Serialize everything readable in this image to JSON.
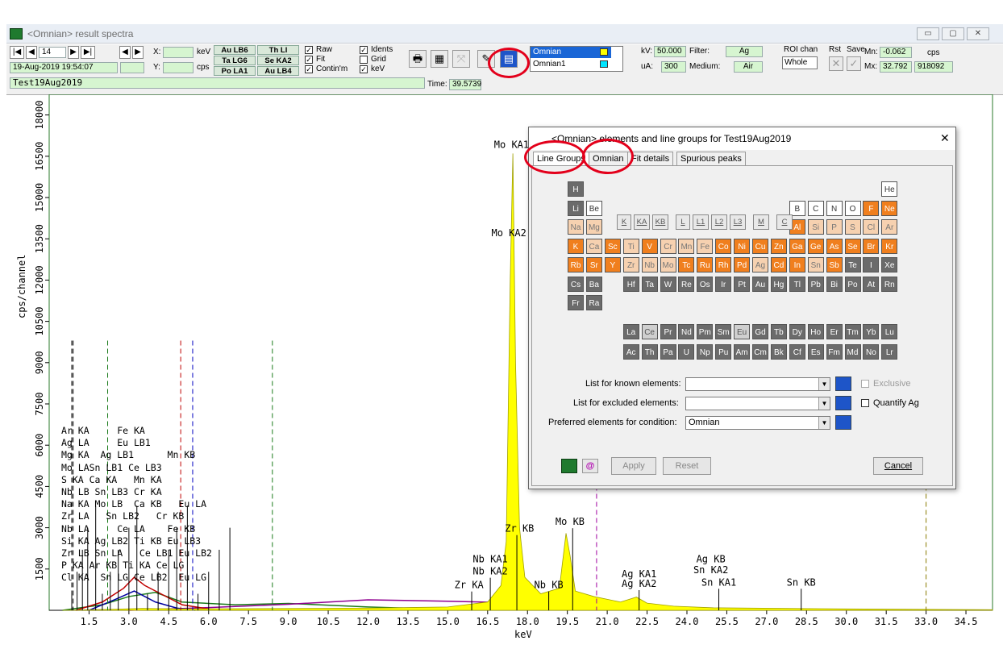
{
  "window": {
    "title": "<Omnian> result spectra",
    "controls": [
      "▭",
      "▢",
      "✕"
    ]
  },
  "toolbar": {
    "spectrum_index": "14",
    "nav": [
      "|◀",
      "◀",
      "▶",
      "▶|"
    ],
    "nav2": [
      "◀",
      "▶"
    ],
    "datetime": "19-Aug-2019 19:54:07",
    "sample_name": "Test19Aug2019",
    "x_label": "X:",
    "x_unit": "keV",
    "y_label": "Y:",
    "y_unit": "cps",
    "line_buttons": [
      "Au LB6",
      "Th Ll",
      "Ta LG6",
      "Se KA2",
      "Po LA1",
      "Au LB4"
    ],
    "checks": {
      "raw": "Raw",
      "fit": "Fit",
      "contin": "Contin'm",
      "idents": "Idents",
      "grid": "Grid",
      "kev": "keV"
    },
    "time_label": "Time:",
    "time_value": "39.5739",
    "spectra_list": [
      "Omnian",
      "Omnian1"
    ],
    "kv_label": "kV:",
    "kv_value": "50.000",
    "ua_label": "uA:",
    "ua_value": "300",
    "filter_label": "Filter:",
    "filter_value": "Ag",
    "medium_label": "Medium:",
    "medium_value": "Air",
    "roi_label": "ROI chan",
    "roi_value": "Whole",
    "rst_label": "Rst",
    "save_label": "Save",
    "mn_label": "Mn:",
    "mn_value": "-0.062",
    "mx_label": "Mx:",
    "mx_value": "32.792",
    "cps_label": "cps",
    "cps_value": "918092",
    "colors": {
      "omnian": "#ffff00",
      "omnian1": "#00e5ff"
    }
  },
  "chart_data": {
    "type": "line",
    "xlabel": "keV",
    "ylabel": "cps/channel",
    "xticks": [
      "1.5",
      "3.0",
      "4.5",
      "6.0",
      "7.5",
      "9.0",
      "10.5",
      "12.0",
      "13.5",
      "15.0",
      "16.5",
      "18.0",
      "19.5",
      "21.0",
      "22.5",
      "24.0",
      "25.5",
      "27.0",
      "28.5",
      "30.0",
      "31.5",
      "33.0",
      "34.5"
    ],
    "yticks": [
      "1500",
      "3000",
      "4500",
      "6000",
      "7500",
      "9000",
      "10500",
      "12000",
      "13500",
      "15000",
      "16500",
      "18000"
    ],
    "xlim": [
      0,
      35.5
    ],
    "ylim": [
      0,
      18750
    ],
    "spectrum": [
      [
        0.5,
        0
      ],
      [
        2.5,
        40
      ],
      [
        3.5,
        70
      ],
      [
        5,
        50
      ],
      [
        8,
        60
      ],
      [
        12,
        80
      ],
      [
        15,
        120
      ],
      [
        16.5,
        300
      ],
      [
        17,
        900
      ],
      [
        17.2,
        2500
      ],
      [
        17.35,
        12000
      ],
      [
        17.45,
        16600
      ],
      [
        17.55,
        9000
      ],
      [
        17.7,
        3000
      ],
      [
        17.9,
        1200
      ],
      [
        18.5,
        600
      ],
      [
        19.2,
        800
      ],
      [
        19.45,
        2800
      ],
      [
        19.6,
        2000
      ],
      [
        19.8,
        700
      ],
      [
        20.5,
        500
      ],
      [
        21.5,
        300
      ],
      [
        22.1,
        480
      ],
      [
        22.5,
        260
      ],
      [
        23.5,
        150
      ],
      [
        25,
        90
      ],
      [
        30,
        50
      ],
      [
        35.5,
        20
      ]
    ],
    "peak_labels": [
      {
        "text": "Mo KA1",
        "x": 17.4,
        "y": 16800
      },
      {
        "text": "Mo KA2",
        "x": 17.3,
        "y": 13600
      },
      {
        "text": "Zr KB",
        "x": 17.7,
        "y": 2850
      },
      {
        "text": "Mo KB",
        "x": 19.6,
        "y": 3100
      },
      {
        "text": "Nb KA1",
        "x": 16.6,
        "y": 1750
      },
      {
        "text": "Nb KA2",
        "x": 16.6,
        "y": 1300
      },
      {
        "text": "Zr KA",
        "x": 15.8,
        "y": 800
      },
      {
        "text": "Nb KB",
        "x": 18.8,
        "y": 800
      },
      {
        "text": "Ag KA1",
        "x": 22.2,
        "y": 1200
      },
      {
        "text": "Ag KA2",
        "x": 22.2,
        "y": 850
      },
      {
        "text": "Ag KB",
        "x": 24.9,
        "y": 1750
      },
      {
        "text": "Sn KA2",
        "x": 24.9,
        "y": 1350
      },
      {
        "text": "Sn KA1",
        "x": 25.2,
        "y": 900
      },
      {
        "text": "Sn KB",
        "x": 28.3,
        "y": 900
      }
    ],
    "cluster_labels": [
      "Ar KA     Fe KA",
      "Ag LA     Eu LB1",
      "Mg KA  Ag LB1      Mn KB",
      "Mo LASn LB1 Ce LB3",
      "S KA Ca KA   Mn KA",
      "Nb LB Sn LB3 Cr KA",
      "Na KA Mo LB  Ca KB   Eu LA",
      "Zr LA   Sn LB2   Cr KB",
      "Nb LA     Ce LA    Fe KB",
      "Si KA Ag LB2 Ti KB Eu LB3",
      "Zr LB Sn LA   Ce LB1 Eu LB2",
      "P KA Ar KB Ti KA Ce LG",
      "Cl KA  Sn LG Ce LB2  Eu LG"
    ]
  },
  "dialog": {
    "title": "<Omnian> elements and line groups for Test19Aug2019",
    "close": "✕",
    "tabs": [
      "Line Groups",
      "Omnian",
      "Fit details",
      "Spurious peaks"
    ],
    "line_group_buttons": [
      "K",
      "KA",
      "KB",
      "L",
      "L1",
      "L2",
      "L3",
      "M",
      "C"
    ],
    "known_label": "List for known elements:",
    "excluded_label": "List for excluded elements:",
    "preferred_label": "Preferred elements for condition:",
    "preferred_value": "Omnian",
    "exclusive_label": "Exclusive",
    "quantify_label": "Quantify Ag",
    "apply_label": "Apply",
    "reset_label": "Reset",
    "cancel_label": "Cancel"
  },
  "periodic": {
    "rows": [
      [
        "H",
        "d"
      ],
      [
        "He",
        "w"
      ],
      [
        "Li",
        "d"
      ],
      [
        "Be",
        "w"
      ],
      [
        "B",
        "w"
      ],
      [
        "C",
        "w"
      ],
      [
        "N",
        "w"
      ],
      [
        "O",
        "w"
      ],
      [
        "F",
        "o"
      ],
      [
        "Ne",
        "o"
      ],
      [
        "Na",
        "l"
      ],
      [
        "Mg",
        "l"
      ],
      [
        "Al",
        "o"
      ],
      [
        "Si",
        "l"
      ],
      [
        "P",
        "l"
      ],
      [
        "S",
        "l"
      ],
      [
        "Cl",
        "l"
      ],
      [
        "Ar",
        "l"
      ],
      [
        "K",
        "o"
      ],
      [
        "Ca",
        "l"
      ],
      [
        "Sc",
        "o"
      ],
      [
        "Ti",
        "l"
      ],
      [
        "V",
        "o"
      ],
      [
        "Cr",
        "l"
      ],
      [
        "Mn",
        "l"
      ],
      [
        "Fe",
        "l"
      ],
      [
        "Co",
        "o"
      ],
      [
        "Ni",
        "o"
      ],
      [
        "Cu",
        "o"
      ],
      [
        "Zn",
        "o"
      ],
      [
        "Ga",
        "o"
      ],
      [
        "Ge",
        "o"
      ],
      [
        "As",
        "o"
      ],
      [
        "Se",
        "o"
      ],
      [
        "Br",
        "o"
      ],
      [
        "Kr",
        "o"
      ],
      [
        "Rb",
        "o"
      ],
      [
        "Sr",
        "o"
      ],
      [
        "Y",
        "o"
      ],
      [
        "Zr",
        "l"
      ],
      [
        "Nb",
        "l"
      ],
      [
        "Mo",
        "l"
      ],
      [
        "Tc",
        "o"
      ],
      [
        "Ru",
        "o"
      ],
      [
        "Rh",
        "o"
      ],
      [
        "Pd",
        "o"
      ],
      [
        "Ag",
        "l"
      ],
      [
        "Cd",
        "o"
      ],
      [
        "In",
        "o"
      ],
      [
        "Sn",
        "l"
      ],
      [
        "Sb",
        "o"
      ],
      [
        "Te",
        "d"
      ],
      [
        "I",
        "d"
      ],
      [
        "Xe",
        "d"
      ],
      [
        "Cs",
        "d"
      ],
      [
        "Ba",
        "d"
      ],
      [
        "Hf",
        "d"
      ],
      [
        "Ta",
        "d"
      ],
      [
        "W",
        "d"
      ],
      [
        "Re",
        "d"
      ],
      [
        "Os",
        "d"
      ],
      [
        "Ir",
        "d"
      ],
      [
        "Pt",
        "d"
      ],
      [
        "Au",
        "d"
      ],
      [
        "Hg",
        "d"
      ],
      [
        "Tl",
        "d"
      ],
      [
        "Pb",
        "d"
      ],
      [
        "Bi",
        "d"
      ],
      [
        "Po",
        "d"
      ],
      [
        "At",
        "d"
      ],
      [
        "Rn",
        "d"
      ],
      [
        "Fr",
        "d"
      ],
      [
        "Ra",
        "d"
      ],
      [
        "La",
        "d"
      ],
      [
        "Ce",
        "g"
      ],
      [
        "Pr",
        "d"
      ],
      [
        "Nd",
        "d"
      ],
      [
        "Pm",
        "d"
      ],
      [
        "Sm",
        "d"
      ],
      [
        "Eu",
        "g"
      ],
      [
        "Gd",
        "d"
      ],
      [
        "Tb",
        "d"
      ],
      [
        "Dy",
        "d"
      ],
      [
        "Ho",
        "d"
      ],
      [
        "Er",
        "d"
      ],
      [
        "Tm",
        "d"
      ],
      [
        "Yb",
        "d"
      ],
      [
        "Lu",
        "d"
      ],
      [
        "Ac",
        "d"
      ],
      [
        "Th",
        "d"
      ],
      [
        "Pa",
        "d"
      ],
      [
        "U",
        "d"
      ],
      [
        "Np",
        "d"
      ],
      [
        "Pu",
        "d"
      ],
      [
        "Am",
        "d"
      ],
      [
        "Cm",
        "d"
      ],
      [
        "Bk",
        "d"
      ],
      [
        "Cf",
        "d"
      ],
      [
        "Es",
        "d"
      ],
      [
        "Fm",
        "d"
      ],
      [
        "Md",
        "d"
      ],
      [
        "No",
        "d"
      ],
      [
        "Lr",
        "d"
      ]
    ]
  }
}
